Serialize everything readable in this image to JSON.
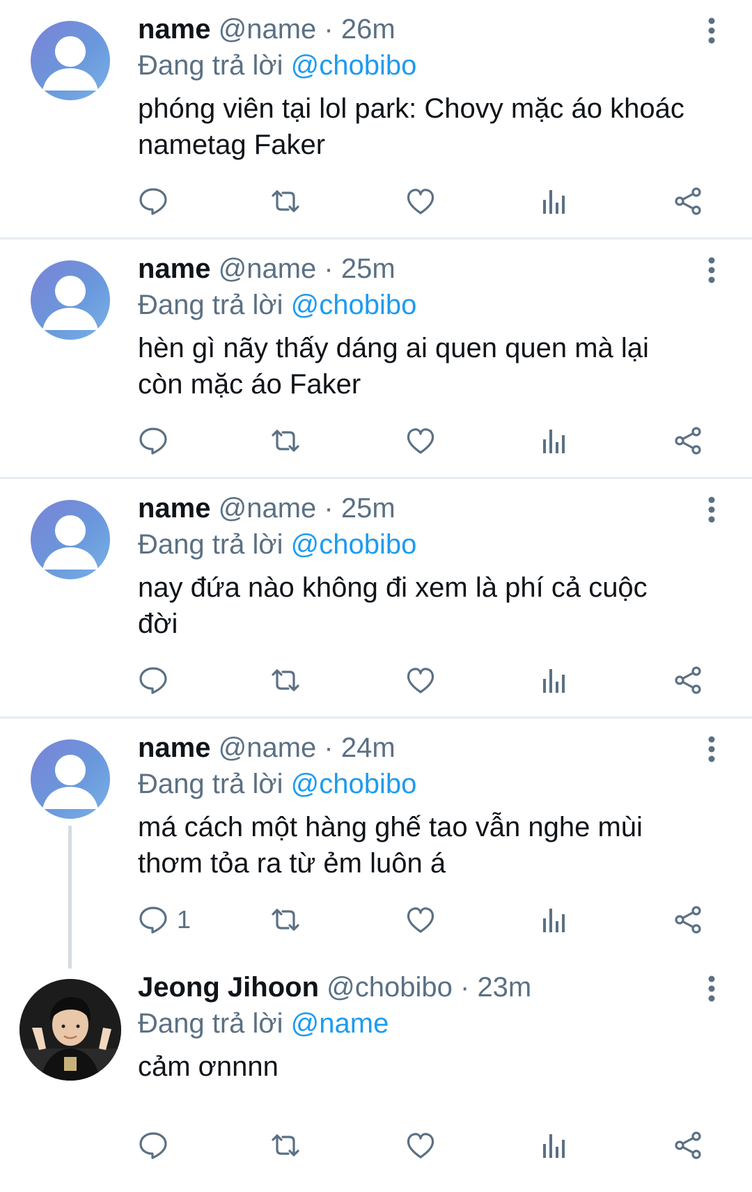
{
  "tweets": [
    {
      "display_name": "name",
      "handle": "@name",
      "separator": "·",
      "time": "26m",
      "replying_prefix": "Đang trả lời",
      "replying_to": "@chobibo",
      "text": "phóng viên tại lol park: Chovy mặc áo khoác\nnametag Faker",
      "reply_count": "",
      "avatar": "default-avatar"
    },
    {
      "display_name": "name",
      "handle": "@name",
      "separator": "·",
      "time": "25m",
      "replying_prefix": "Đang trả lời",
      "replying_to": "@chobibo",
      "text": "hèn gì nãy thấy dáng ai quen quen mà lại\ncòn mặc áo Faker",
      "reply_count": "",
      "avatar": "default-avatar"
    },
    {
      "display_name": "name",
      "handle": "@name",
      "separator": "·",
      "time": "25m",
      "replying_prefix": "Đang trả lời",
      "replying_to": "@chobibo",
      "text": "nay đứa nào không đi xem là phí cả cuộc\nđời",
      "reply_count": "",
      "avatar": "default-avatar"
    },
    {
      "display_name": "name",
      "handle": "@name",
      "separator": "·",
      "time": "24m",
      "replying_prefix": "Đang trả lời",
      "replying_to": "@chobibo",
      "text": "má cách một hàng ghế tao vẫn nghe mùi\nthơm tỏa ra từ ẻm luôn á",
      "reply_count": "1",
      "avatar": "default-avatar"
    },
    {
      "display_name": "Jeong Jihoon",
      "handle": "@chobibo",
      "separator": "·",
      "time": "23m",
      "replying_prefix": "Đang trả lời",
      "replying_to": "@name",
      "text": "cảm ơnnnn",
      "reply_count": "",
      "avatar": "photo-avatar"
    }
  ],
  "icons": {
    "reply": "reply-icon",
    "retweet": "retweet-icon",
    "like": "heart-icon",
    "stats": "analytics-icon",
    "share": "share-icon",
    "more": "more-vertical-icon"
  },
  "colors": {
    "link": "#1d9bf0",
    "secondary_text": "#5b7083",
    "divider": "#e6ecf0"
  }
}
